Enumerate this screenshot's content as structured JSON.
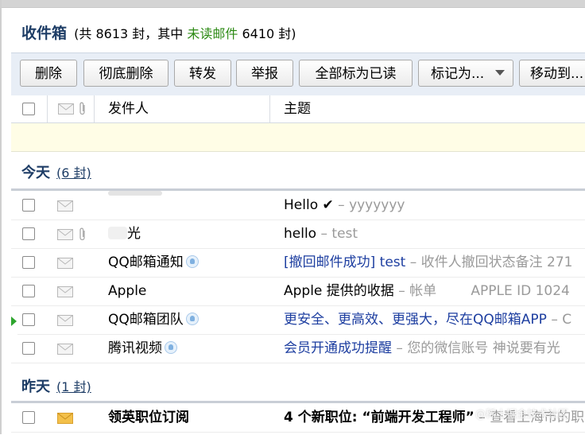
{
  "header": {
    "title": "收件箱",
    "stats_prefix": "(共",
    "total_count": "8613",
    "stats_mid": "封，其中",
    "unread_label": "未读邮件",
    "unread_count": "6410",
    "stats_suffix": "封)"
  },
  "toolbar": {
    "delete": "删除",
    "delete_permanent": "彻底删除",
    "forward": "转发",
    "report": "举报",
    "mark_all_read": "全部标为已读",
    "mark_as": "标记为...",
    "move_to": "移动到..."
  },
  "columns": {
    "sender": "发件人",
    "subject": "主题"
  },
  "groups": {
    "today": {
      "title": "今天",
      "count": "(6 封)"
    },
    "yesterday": {
      "title": "昨天",
      "count": "(1 封)"
    }
  },
  "emails": [
    {
      "sender": "",
      "subject": "Hello ✔",
      "separator": "–",
      "snippet": "yyyyyyy"
    },
    {
      "sender": "光",
      "subject": "hello",
      "separator": "–",
      "snippet": "test"
    },
    {
      "sender": "QQ邮箱通知",
      "subject": "[撤回邮件成功] test",
      "separator": "–",
      "snippet": "收件人撤回状态备注 271"
    },
    {
      "sender": "Apple",
      "subject": "Apple 提供的收据",
      "separator": "–",
      "snippet": "帐单        APPLE ID 1024"
    },
    {
      "sender": "QQ邮箱团队",
      "subject": "更安全、更高效、更强大，尽在QQ邮箱APP",
      "separator": "–",
      "snippet": "C"
    },
    {
      "sender": "腾讯视频",
      "subject": "会员开通成功提醒",
      "separator": "–",
      "snippet": "您的微信账号 神说要有光"
    },
    {
      "sender": "领英职位订阅",
      "subject": "4 个新职位: “前端开发工程师”",
      "separator": "–",
      "snippet": "查看上海市的职"
    }
  ],
  "watermark": "@稀土掘金技术社区",
  "colors": {
    "title": "#1e3d66",
    "unread": "#2c8a14",
    "link_subject": "#1d3ea0",
    "snippet": "#9a9a9a",
    "toolbar_bg": "#e8eef6",
    "notice_bg": "#fffde6",
    "unread_envelope": "#f3c04a"
  },
  "icons": {
    "envelope": "envelope-icon",
    "attachment": "paperclip-icon",
    "qq_badge": "qq-verified-icon",
    "pointer": "current-row-arrow-icon"
  }
}
